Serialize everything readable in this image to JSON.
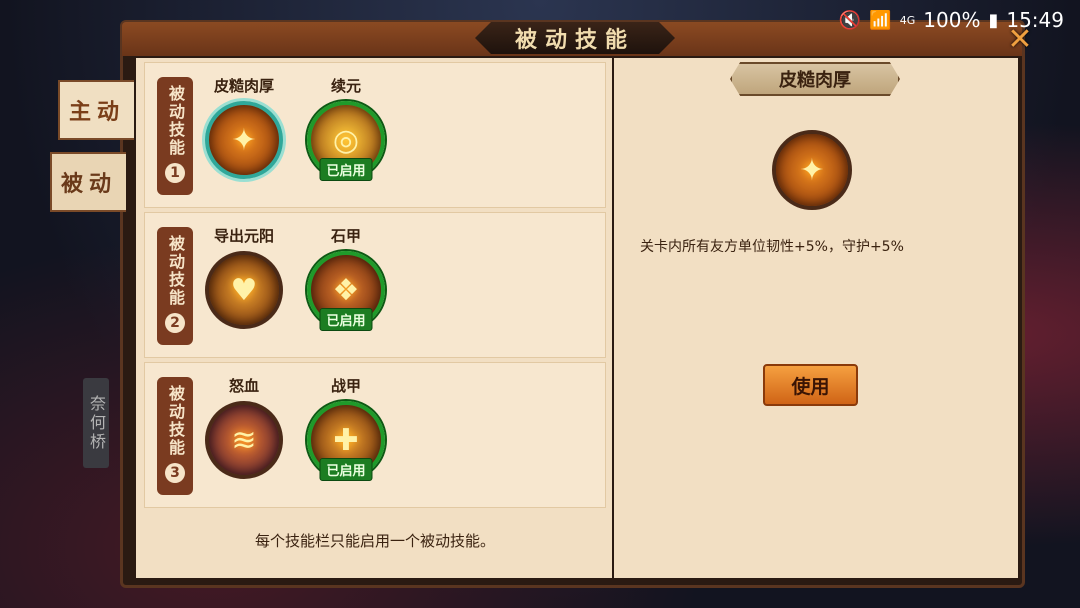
{
  "status_bar": {
    "battery": "100%",
    "time": "15:49",
    "network": "4G"
  },
  "dialog_title": "被动技能",
  "side_tabs": {
    "active": "主动",
    "passive": "被动",
    "bridge": "奈何桥"
  },
  "rows": [
    {
      "label": "被动技能",
      "number": "1",
      "skills": [
        {
          "name": "皮糙肉厚",
          "icon": "armor-shard-icon",
          "status": ""
        },
        {
          "name": "续元",
          "icon": "energy-orb-icon",
          "status": "已启用"
        }
      ]
    },
    {
      "label": "被动技能",
      "number": "2",
      "skills": [
        {
          "name": "导出元阳",
          "icon": "heart-icon",
          "status": ""
        },
        {
          "name": "石甲",
          "icon": "stone-armor-icon",
          "status": "已启用"
        }
      ]
    },
    {
      "label": "被动技能",
      "number": "3",
      "skills": [
        {
          "name": "怒血",
          "icon": "blood-claw-icon",
          "status": ""
        },
        {
          "name": "战甲",
          "icon": "battle-armor-icon",
          "status": "已启用"
        }
      ]
    }
  ],
  "footer_note": "每个技能栏只能启用一个被动技能。",
  "detail": {
    "name": "皮糙肉厚",
    "icon": "armor-shard-icon",
    "description": "关卡内所有友方单位韧性+5%，守护+5%",
    "use_button": "使用"
  },
  "colors": {
    "enabled_border": "#1f9a2a",
    "selected_border": "#2fa89a",
    "panel_bg": "#f2dfc3"
  }
}
